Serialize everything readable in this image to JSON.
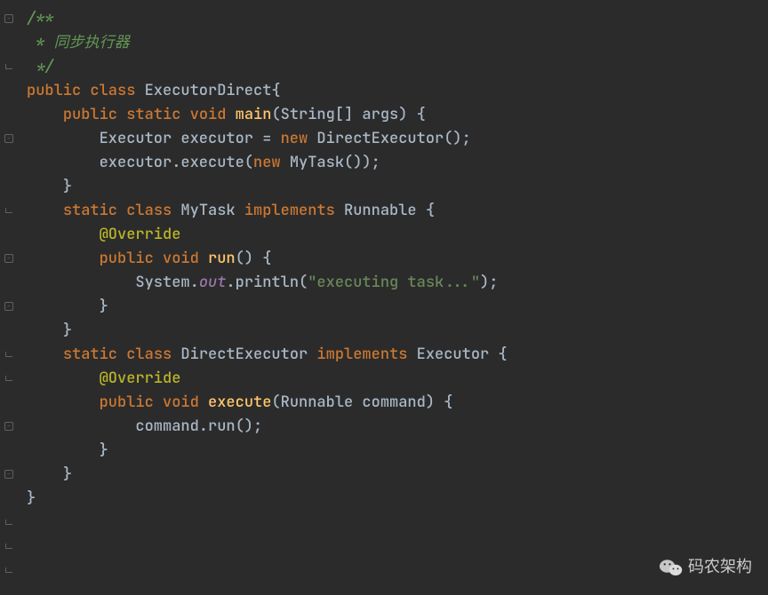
{
  "code": {
    "lines": [
      {
        "indent": 0,
        "tokens": [
          {
            "t": "/**",
            "c": "c-comment"
          }
        ]
      },
      {
        "indent": 0,
        "tokens": [
          {
            "t": " * 同步执行器",
            "c": "c-comment"
          }
        ]
      },
      {
        "indent": 0,
        "tokens": [
          {
            "t": " */",
            "c": "c-comment"
          }
        ]
      },
      {
        "indent": 0,
        "tokens": [
          {
            "t": "public ",
            "c": "c-keyword"
          },
          {
            "t": "class ",
            "c": "c-keyword"
          },
          {
            "t": "ExecutorDirect",
            "c": "c-class"
          },
          {
            "t": "{",
            "c": "c-punct"
          }
        ]
      },
      {
        "indent": 0,
        "tokens": [
          {
            "t": "",
            "c": ""
          }
        ]
      },
      {
        "indent": 1,
        "tokens": [
          {
            "t": "public ",
            "c": "c-keyword"
          },
          {
            "t": "static ",
            "c": "c-keyword"
          },
          {
            "t": "void ",
            "c": "c-keyword"
          },
          {
            "t": "main",
            "c": "c-method"
          },
          {
            "t": "(String[] args) {",
            "c": "c-param"
          }
        ]
      },
      {
        "indent": 2,
        "tokens": [
          {
            "t": "Executor executor = ",
            "c": "c-class"
          },
          {
            "t": "new ",
            "c": "c-keyword"
          },
          {
            "t": "DirectExecutor();",
            "c": "c-class"
          }
        ]
      },
      {
        "indent": 2,
        "tokens": [
          {
            "t": "executor.execute(",
            "c": "c-class"
          },
          {
            "t": "new ",
            "c": "c-keyword"
          },
          {
            "t": "MyTask());",
            "c": "c-class"
          }
        ]
      },
      {
        "indent": 1,
        "tokens": [
          {
            "t": "}",
            "c": "c-punct"
          }
        ]
      },
      {
        "indent": 0,
        "tokens": [
          {
            "t": "",
            "c": ""
          }
        ]
      },
      {
        "indent": 1,
        "tokens": [
          {
            "t": "static ",
            "c": "c-keyword"
          },
          {
            "t": "class ",
            "c": "c-keyword"
          },
          {
            "t": "MyTask ",
            "c": "c-class"
          },
          {
            "t": "implements ",
            "c": "c-keyword"
          },
          {
            "t": "Runnable {",
            "c": "c-class"
          }
        ]
      },
      {
        "indent": 2,
        "tokens": [
          {
            "t": "@Override",
            "c": "c-annotation"
          }
        ]
      },
      {
        "indent": 2,
        "tokens": [
          {
            "t": "public ",
            "c": "c-keyword"
          },
          {
            "t": "void ",
            "c": "c-keyword"
          },
          {
            "t": "run",
            "c": "c-method"
          },
          {
            "t": "() {",
            "c": "c-punct"
          }
        ]
      },
      {
        "indent": 3,
        "tokens": [
          {
            "t": "System.",
            "c": "c-class"
          },
          {
            "t": "out",
            "c": "c-static"
          },
          {
            "t": ".println(",
            "c": "c-class"
          },
          {
            "t": "\"executing task...\"",
            "c": "c-string"
          },
          {
            "t": ");",
            "c": "c-punct"
          }
        ]
      },
      {
        "indent": 2,
        "tokens": [
          {
            "t": "}",
            "c": "c-punct"
          }
        ]
      },
      {
        "indent": 1,
        "tokens": [
          {
            "t": "}",
            "c": "c-punct"
          }
        ]
      },
      {
        "indent": 0,
        "tokens": [
          {
            "t": "",
            "c": ""
          }
        ]
      },
      {
        "indent": 1,
        "tokens": [
          {
            "t": "static ",
            "c": "c-keyword"
          },
          {
            "t": "class ",
            "c": "c-keyword"
          },
          {
            "t": "DirectExecutor ",
            "c": "c-class"
          },
          {
            "t": "implements ",
            "c": "c-keyword"
          },
          {
            "t": "Executor {",
            "c": "c-class"
          }
        ]
      },
      {
        "indent": 2,
        "tokens": [
          {
            "t": "@Override",
            "c": "c-annotation"
          }
        ]
      },
      {
        "indent": 2,
        "tokens": [
          {
            "t": "public ",
            "c": "c-keyword"
          },
          {
            "t": "void ",
            "c": "c-keyword"
          },
          {
            "t": "execute",
            "c": "c-method"
          },
          {
            "t": "(Runnable command) {",
            "c": "c-param"
          }
        ]
      },
      {
        "indent": 3,
        "tokens": [
          {
            "t": "command.run();",
            "c": "c-class"
          }
        ]
      },
      {
        "indent": 2,
        "tokens": [
          {
            "t": "}",
            "c": "c-punct"
          }
        ]
      },
      {
        "indent": 1,
        "tokens": [
          {
            "t": "}",
            "c": "c-punct"
          }
        ]
      },
      {
        "indent": 0,
        "tokens": [
          {
            "t": "}",
            "c": "c-punct"
          }
        ]
      }
    ]
  },
  "gutterMarks": [
    {
      "line": 0,
      "type": "fold-open"
    },
    {
      "line": 2,
      "type": "fold-close"
    },
    {
      "line": 5,
      "type": "fold-open"
    },
    {
      "line": 8,
      "type": "fold-close"
    },
    {
      "line": 10,
      "type": "fold-open"
    },
    {
      "line": 12,
      "type": "fold-open"
    },
    {
      "line": 14,
      "type": "fold-close"
    },
    {
      "line": 15,
      "type": "fold-close"
    },
    {
      "line": 17,
      "type": "fold-open"
    },
    {
      "line": 19,
      "type": "fold-open"
    },
    {
      "line": 21,
      "type": "fold-close"
    },
    {
      "line": 22,
      "type": "fold-close"
    },
    {
      "line": 23,
      "type": "fold-close"
    }
  ],
  "watermark": {
    "text": "码农架构"
  },
  "indentUnit": "    "
}
